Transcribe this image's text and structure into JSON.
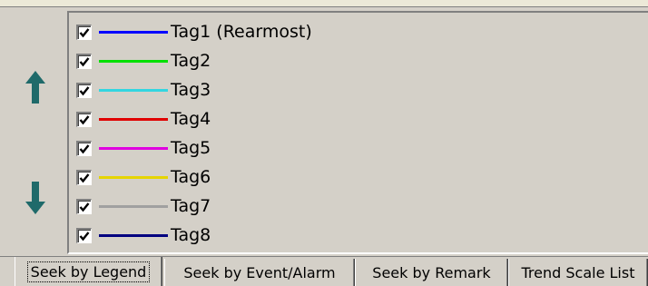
{
  "legend": {
    "up_icon": "arrow-up-icon",
    "down_icon": "arrow-down-icon",
    "arrow_color": "#1f6a6a",
    "items": [
      {
        "label": "Tag1 (Rearmost)",
        "color": "#0000ff",
        "checked": true
      },
      {
        "label": "Tag2",
        "color": "#00e000",
        "checked": true
      },
      {
        "label": "Tag3",
        "color": "#33d6e0",
        "checked": true
      },
      {
        "label": "Tag4",
        "color": "#e00000",
        "checked": true
      },
      {
        "label": "Tag5",
        "color": "#e000e0",
        "checked": true
      },
      {
        "label": "Tag6",
        "color": "#e6d400",
        "checked": true
      },
      {
        "label": "Tag7",
        "color": "#a0a0a0",
        "checked": true
      },
      {
        "label": "Tag8",
        "color": "#000080",
        "checked": true
      }
    ]
  },
  "tabs": [
    {
      "label": "Seek by Legend",
      "active": true
    },
    {
      "label": "Seek by Event/Alarm",
      "active": false
    },
    {
      "label": "Seek by Remark",
      "active": false
    },
    {
      "label": "Trend Scale List",
      "active": false
    }
  ]
}
